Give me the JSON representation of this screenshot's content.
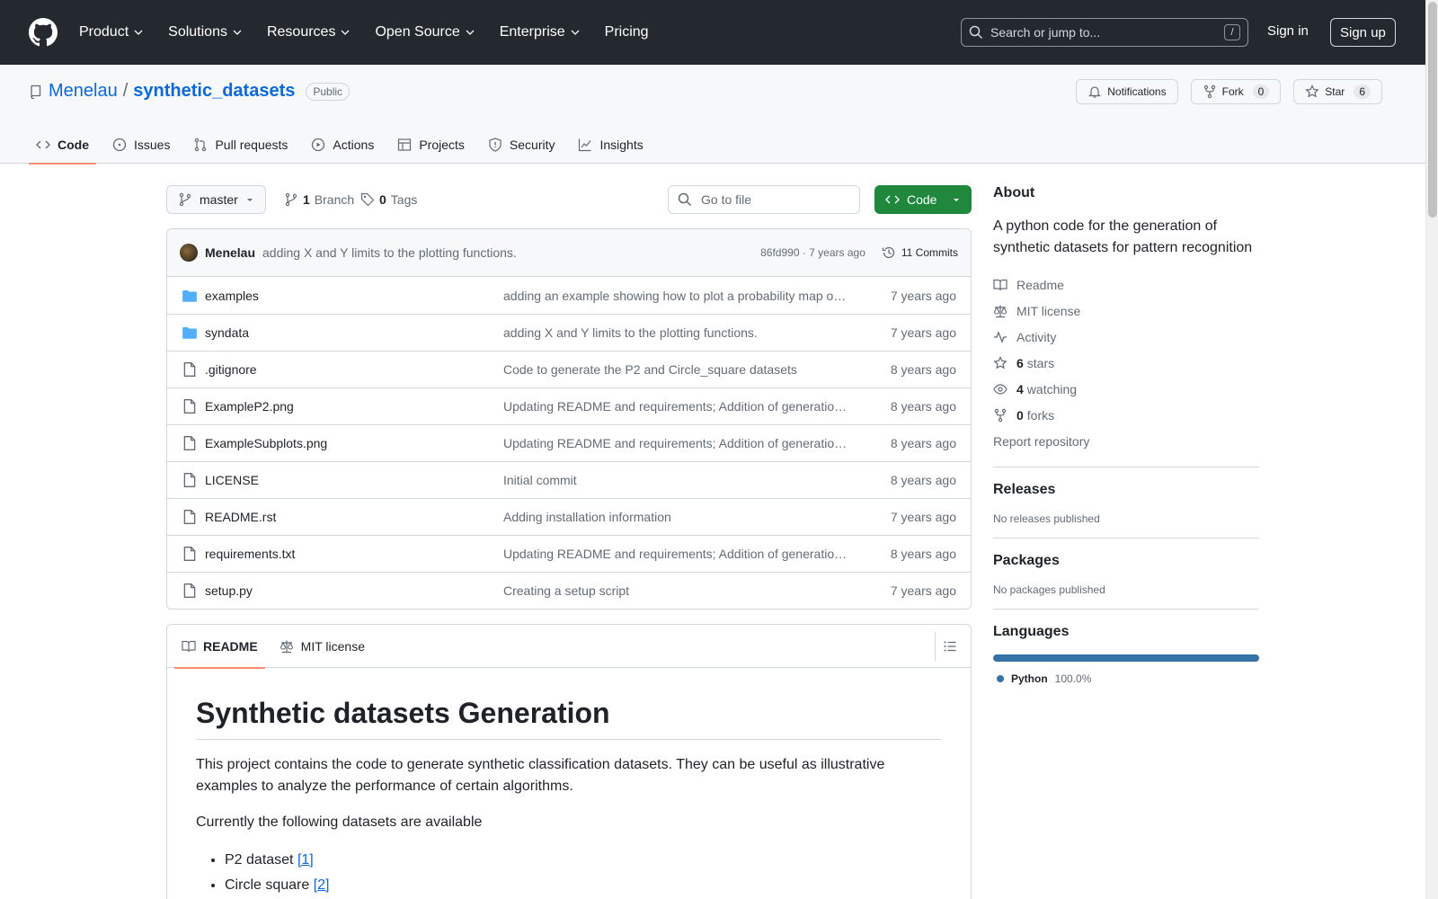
{
  "header": {
    "nav": [
      "Product",
      "Solutions",
      "Resources",
      "Open Source",
      "Enterprise"
    ],
    "pricing": "Pricing",
    "search_placeholder": "Search or jump to...",
    "search_key": "/",
    "sign_in": "Sign in",
    "sign_up": "Sign up"
  },
  "repo": {
    "owner": "Menelau",
    "separator": "/",
    "name": "synthetic_datasets",
    "visibility": "Public",
    "notifications_label": "Notifications",
    "fork_label": "Fork",
    "fork_count": "0",
    "star_label": "Star",
    "star_count": "6"
  },
  "tabs": [
    "Code",
    "Issues",
    "Pull requests",
    "Actions",
    "Projects",
    "Security",
    "Insights"
  ],
  "toolbar": {
    "branch": "master",
    "branch_count": "1",
    "branch_label": "Branch",
    "tag_count": "0",
    "tag_label": "Tags",
    "goto_placeholder": "Go to file",
    "code_label": "Code"
  },
  "commit": {
    "author": "Menelau",
    "message": "adding X and Y limits to the plotting functions.",
    "hash_age": "86fd990 · 7 years ago",
    "commits": "11 Commits"
  },
  "files": [
    {
      "name": "examples",
      "type": "folder",
      "message": "adding an example showing how to plot a probability map o…",
      "age": "7 years ago"
    },
    {
      "name": "syndata",
      "type": "folder",
      "message": "adding X and Y limits to the plotting functions.",
      "age": "7 years ago"
    },
    {
      "name": ".gitignore",
      "type": "file",
      "message": "Code to generate the P2 and Circle_square datasets",
      "age": "8 years ago"
    },
    {
      "name": "ExampleP2.png",
      "type": "file",
      "message": "Updating README and requirements; Addition of generatio…",
      "age": "8 years ago"
    },
    {
      "name": "ExampleSubplots.png",
      "type": "file",
      "message": "Updating README and requirements; Addition of generatio…",
      "age": "8 years ago"
    },
    {
      "name": "LICENSE",
      "type": "file",
      "message": "Initial commit",
      "age": "8 years ago"
    },
    {
      "name": "README.rst",
      "type": "file",
      "message": "Adding installation information",
      "age": "7 years ago"
    },
    {
      "name": "requirements.txt",
      "type": "file",
      "message": "Updating README and requirements; Addition of generatio…",
      "age": "8 years ago"
    },
    {
      "name": "setup.py",
      "type": "file",
      "message": "Creating a setup script",
      "age": "7 years ago"
    }
  ],
  "readme": {
    "tab_readme": "README",
    "tab_license": "MIT license",
    "title": "Synthetic datasets Generation",
    "para1": "This project contains the code to generate synthetic classification datasets. They can be useful as illustrative examples to analyze the performance of certain algorithms.",
    "para2": "Currently the following datasets are available",
    "list": [
      {
        "text": "P2 dataset ",
        "ref": "[1]"
      },
      {
        "text": "Circle square ",
        "ref": "[2]"
      }
    ]
  },
  "about": {
    "title": "About",
    "description": "A python code for the generation of synthetic datasets for pattern recognition",
    "readme": "Readme",
    "license": "MIT license",
    "activity": "Activity",
    "stars_count": "6",
    "stars_label": "stars",
    "watching_count": "4",
    "watching_label": "watching",
    "forks_count": "0",
    "forks_label": "forks",
    "report": "Report repository"
  },
  "releases": {
    "title": "Releases",
    "empty": "No releases published"
  },
  "packages": {
    "title": "Packages",
    "empty": "No packages published"
  },
  "languages": {
    "title": "Languages",
    "name": "Python",
    "percent": "100.0%",
    "color": "#3572A5"
  }
}
